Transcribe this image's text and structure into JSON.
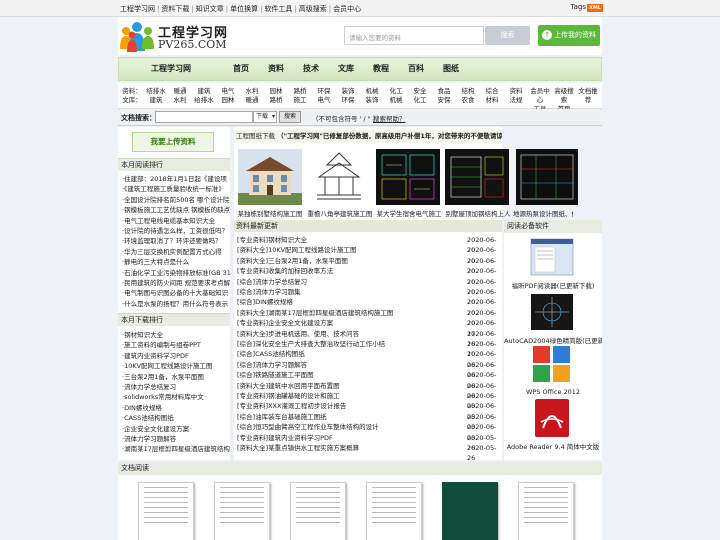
{
  "topbar": {
    "links": [
      "工程学习网",
      "资料下载",
      "知识文章",
      "单位换算",
      "软件工具",
      "高级搜索",
      "会员中心"
    ],
    "tags_label": "Tags",
    "xml_badge": "XML"
  },
  "header": {
    "logo_cn": "工程学习网",
    "logo_en": "PV265.COM",
    "search_placeholder": "请输入您要的资料",
    "search_button": "搜索",
    "upload_button": "上传我的资料"
  },
  "mainnav": {
    "brand": "工程学习网",
    "items": [
      "首页",
      "资料",
      "技术",
      "文库",
      "教程",
      "百科",
      "图纸"
    ]
  },
  "subnav": [
    [
      "资料：",
      "文库："
    ],
    [
      "结排水",
      "建筑"
    ],
    [
      "暖通",
      "水利"
    ],
    [
      "建筑",
      "给排水"
    ],
    [
      "电气",
      "园林"
    ],
    [
      "水利",
      "暖通"
    ],
    [
      "园林",
      "路桥"
    ],
    [
      "路桥",
      "施工"
    ],
    [
      "环保",
      "电气"
    ],
    [
      "装饰",
      "环保"
    ],
    [
      "机械",
      "装饰"
    ],
    [
      "化工",
      "机械"
    ],
    [
      "安全",
      "化工"
    ],
    [
      "食品",
      "安保"
    ],
    [
      "结构",
      "农食"
    ],
    [
      "综合",
      "材料"
    ],
    [
      "资料",
      "法规"
    ],
    [
      "会员中心",
      "工具"
    ],
    [
      "高级搜索",
      "首页"
    ],
    [
      "文档推荐",
      ""
    ]
  ],
  "docsearch": {
    "label": "文档搜索：",
    "select_value": "下载",
    "button": "搜索",
    "hint": "（不可包含符号 ' / \" ）",
    "help": "搜索帮助？"
  },
  "left": {
    "vip_button": "我要上传资料",
    "month_read_title": "本月阅读排行",
    "month_read": [
      "·住建部：2018年1月1日起《建设项",
      "·《建筑工程施工质量验收统一标准》",
      "·全国设计院排名前500名 哪个设计院",
      "·钢模板施工工艺优缺点 钢模板的缺点",
      "·电气工程电线电缆基本知识大全",
      "·设计院的待遇怎么样，工资很低吗？",
      "·环境监理取消了？环评还要做吗？",
      "·华为三层交换机实例配置方式心得",
      "·静电的三大特点是什么",
      "·石油化学工业污染物排放标准(GB 31",
      "·民用建筑的防火间距 规范要求考点解",
      "·电气制图与识图必备的十大基础知识",
      "·什么是水泵的扬程？用什么符号表示"
    ],
    "month_download_title": "本月下载排行",
    "month_download": [
      "·钢材知识大全",
      "·施工资料的编制与组卷PPT",
      "·建筑内业资料学习PDF",
      "·10KV配网工程线路设计施工图",
      "·三台泵2用1备，水泵平面图",
      "·流体力学总结复习",
      "·solidworks常用材料库中文",
      "·DIN螺纹规格",
      "·CASS池结构图纸",
      "·企业安全文化建设方案",
      "·流体力学习题解答",
      "·湖南某17层框剪四星级酒店建筑结构"
    ]
  },
  "middle": {
    "gallery_title": "工程图纸下载",
    "gallery_notice": "（\"工程学习网\"已修复部份数据，原高级用户补偿1年，对您带来的不便敬请谅解！）",
    "gallery": [
      "某独栋别墅结构施工图",
      "重檐八角亭建筑施工图",
      "某大学生宿舍电气施工",
      "别墅屋顶加钢结构上人",
      "地源热泵设计图纸、供"
    ],
    "news_title": "资料最新更新",
    "news": [
      {
        "title": "[专业资料]钢材知识大全",
        "date": "2020-06-20"
      },
      {
        "title": "[资料大全]10KV配网工程线路设计施工图",
        "date": "2020-06-20"
      },
      {
        "title": "[资料大全]三台泵2用1备，水泵平面图",
        "date": "2020-06-20"
      },
      {
        "title": "[专业资料]收集的加标回收率方法",
        "date": "2020-06-20"
      },
      {
        "title": "[综合]流体力学总结复习",
        "date": "2020-06-20"
      },
      {
        "title": "[综合]流体力学习题集",
        "date": "2020-06-20"
      },
      {
        "title": "[综合]DIN螺纹规格",
        "date": "2020-06-20"
      },
      {
        "title": "[资料大全]湖南某17层框剪四星级酒店建筑结构施工图",
        "date": "2020-06-20"
      },
      {
        "title": "[专业资料]企业安全文化建设方案",
        "date": "2020-06-17"
      },
      {
        "title": "[资料大全]步进电机选用、使用、技术问答",
        "date": "2020-06-16"
      },
      {
        "title": "[综合]深化安全生产大排查大整治攻坚行动工作小结",
        "date": "2020-06-10"
      },
      {
        "title": "[综合]CASS池结构图纸",
        "date": "2020-06-06"
      },
      {
        "title": "[综合]流体力学习题解答",
        "date": "2020-06-06"
      },
      {
        "title": "[综合]铁路隧道施工平面图",
        "date": "2020-06-06"
      },
      {
        "title": "[资料大全]建筑中水回用平面布置图",
        "date": "2020-06-06"
      },
      {
        "title": "[专业资料]钢油罐基础的设计和施工",
        "date": "2020-06-05"
      },
      {
        "title": "[专业资料]XXX灌溉工程初步设计报告",
        "date": "2020-06-05"
      },
      {
        "title": "[综合]油库装车台基础施工图纸",
        "date": "2020-06-03"
      },
      {
        "title": "[综合]恒巧型曲臂高空工程作业车整体结构的设计",
        "date": "2020-06-03"
      },
      {
        "title": "[专业资料]建筑内业资料学习PDF",
        "date": "2020-05-26"
      },
      {
        "title": "[资料大全]某重点镇供水工程实施方案概算",
        "date": "2020-05-26"
      }
    ]
  },
  "right": {
    "title": "阅读必备软件",
    "items": [
      "福昕PDF阅读器(已更新下载)",
      "AutoCAD2004绿色精简版(已更新",
      "WPS Office 2012",
      "Adobe Reader 9.4 简体中文版"
    ]
  },
  "bottom": {
    "title": "文档阅读"
  }
}
